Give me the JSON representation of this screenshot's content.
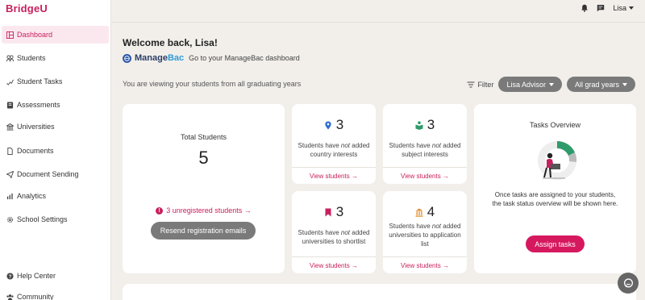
{
  "app": {
    "logo": "BridgeU"
  },
  "sidebar": {
    "items": [
      {
        "label": "Dashboard",
        "icon": "dashboard-icon",
        "active": true
      },
      {
        "label": "Students",
        "icon": "students-icon"
      },
      {
        "label": "Student Tasks",
        "icon": "tasks-icon"
      },
      {
        "label": "Assessments",
        "icon": "assessments-icon"
      },
      {
        "label": "Universities",
        "icon": "university-icon"
      },
      {
        "label": "Documents",
        "icon": "document-icon"
      },
      {
        "label": "Document Sending",
        "icon": "send-icon"
      },
      {
        "label": "Analytics",
        "icon": "analytics-icon"
      },
      {
        "label": "School Settings",
        "icon": "gear-icon"
      }
    ],
    "bottom": [
      {
        "label": "Help Center",
        "icon": "help-icon"
      },
      {
        "label": "Community",
        "icon": "community-icon"
      }
    ]
  },
  "header": {
    "user_name": "Lisa"
  },
  "main": {
    "welcome": "Welcome back, Lisa!",
    "managebac": {
      "name_part1": "Manage",
      "name_part2": "Bac",
      "link": "Go to your ManageBac dashboard"
    },
    "viewing_text": "You are viewing your students from all graduating years",
    "filter_label": "Filter",
    "advisor_select": "Lisa Advisor",
    "year_select": "All grad years"
  },
  "total_card": {
    "title": "Total Students",
    "value": "5",
    "unregistered": "3 unregistered students →",
    "resend_button": "Resend registration emails"
  },
  "stat_cards": [
    {
      "icon": "location-pin-icon",
      "count": "3",
      "desc_before": "Students have ",
      "desc_em": "not",
      "desc_after": " added country interests",
      "link": "View students →"
    },
    {
      "icon": "book-reader-icon",
      "count": "3",
      "desc_before": "Students have ",
      "desc_em": "not",
      "desc_after": " added subject interests",
      "link": "View students →"
    },
    {
      "icon": "bookmark-icon",
      "count": "3",
      "desc_before": "Students have ",
      "desc_em": "not",
      "desc_after": " added universities to shortlist",
      "link": "View students →"
    },
    {
      "icon": "university-building-icon",
      "count": "4",
      "desc_before": "Students have ",
      "desc_em": "not",
      "desc_after": " added universities to application list",
      "link": "View students →"
    }
  ],
  "tasks_card": {
    "title": "Tasks Overview",
    "description": "Once tasks are assigned to your students, the task status overview will be shown here.",
    "button": "Assign tasks"
  },
  "colors": {
    "brand": "#c8205d",
    "brand_button": "#d6185f",
    "pin": "#2f6fd1",
    "book": "#2e9b6a",
    "bookmark": "#c8205d",
    "building": "#e08b2a"
  }
}
